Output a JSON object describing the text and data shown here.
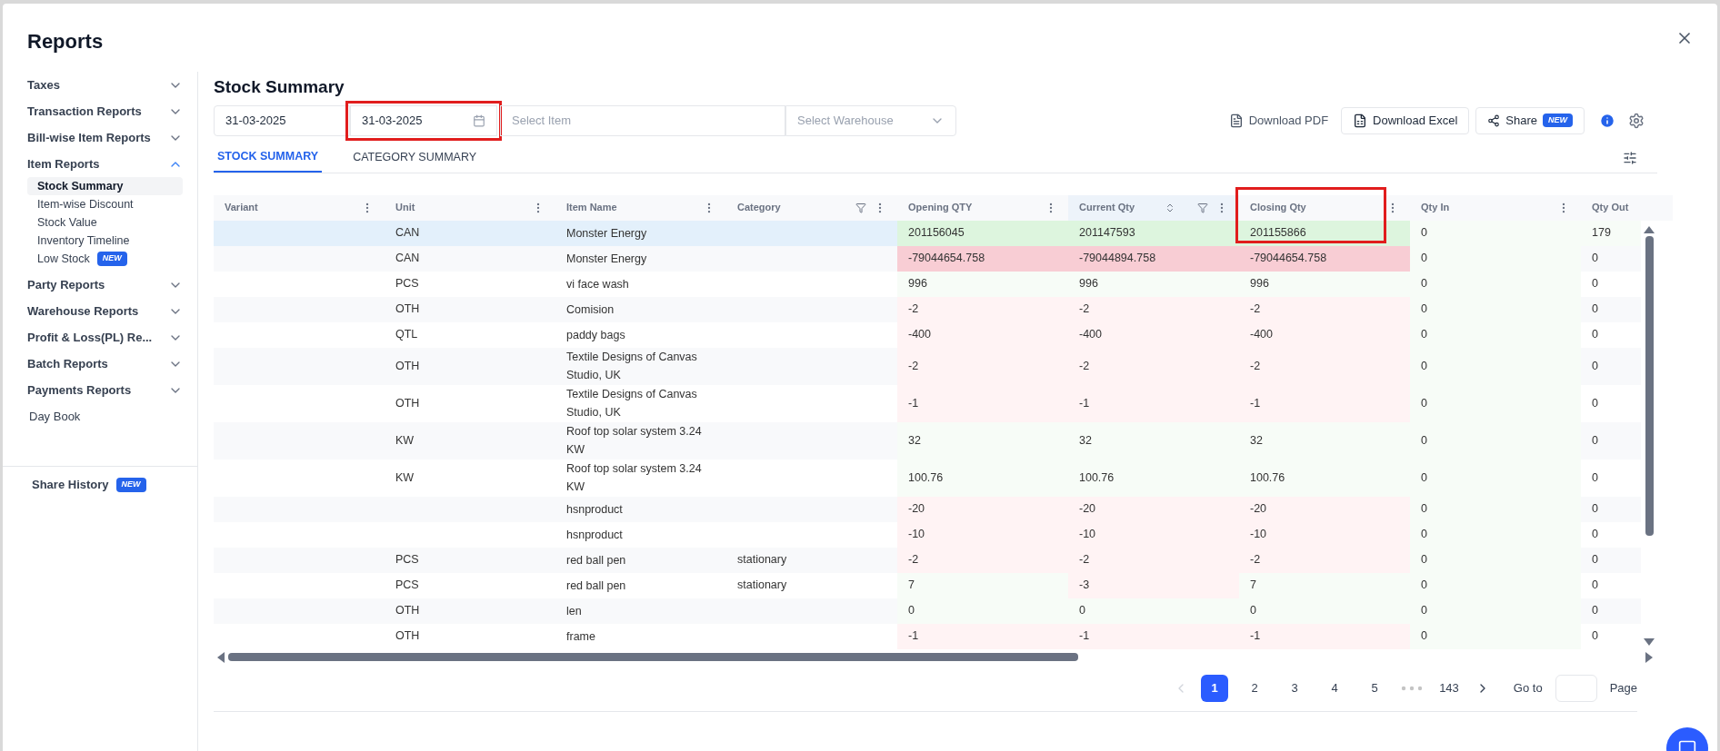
{
  "title": "Reports",
  "sidebar": {
    "items": [
      {
        "kind": "group",
        "label": "Taxes",
        "expanded": false
      },
      {
        "kind": "group",
        "label": "Transaction Reports",
        "expanded": false
      },
      {
        "kind": "group",
        "label": "Bill-wise Item Reports",
        "expanded": false
      },
      {
        "kind": "group",
        "label": "Item Reports",
        "expanded": true,
        "children": [
          {
            "label": "Stock Summary",
            "selected": true
          },
          {
            "label": "Item-wise Discount",
            "selected": false
          },
          {
            "label": "Stock Value",
            "selected": false
          },
          {
            "label": "Inventory Timeline",
            "selected": false
          },
          {
            "label": "Low Stock",
            "selected": false,
            "badge": "NEW"
          }
        ]
      },
      {
        "kind": "group",
        "label": "Party Reports",
        "expanded": false
      },
      {
        "kind": "group",
        "label": "Warehouse Reports",
        "expanded": false
      },
      {
        "kind": "group",
        "label": "Profit & Loss(PL) Re...",
        "expanded": false
      },
      {
        "kind": "group",
        "label": "Batch Reports",
        "expanded": false
      },
      {
        "kind": "group",
        "label": "Payments Reports",
        "expanded": false
      },
      {
        "kind": "link",
        "label": "Day Book"
      }
    ],
    "footer": {
      "label": "Share History",
      "badge": "NEW"
    }
  },
  "heading": "Stock Summary",
  "filters": {
    "start_date": {
      "value": "31-03-2025",
      "highlighted": false
    },
    "end_date": {
      "value": "31-03-2025",
      "highlighted": true
    },
    "item": {
      "placeholder": "Select Item"
    },
    "warehouse": {
      "placeholder": "Select Warehouse"
    }
  },
  "actions": {
    "download_pdf": "Download PDF",
    "download_excel": "Download Excel",
    "share": "Share",
    "share_badge": "NEW"
  },
  "tabs": [
    {
      "label": "STOCK SUMMARY",
      "selected": true
    },
    {
      "label": "CATEGORY SUMMARY",
      "selected": false
    }
  ],
  "table": {
    "columns": [
      {
        "label": "Variant",
        "filter": false,
        "sort": false,
        "menu": true,
        "highlighted": false
      },
      {
        "label": "Unit",
        "filter": false,
        "sort": false,
        "menu": true,
        "highlighted": false
      },
      {
        "label": "Item Name",
        "filter": false,
        "sort": false,
        "menu": true,
        "highlighted": false
      },
      {
        "label": "Category",
        "filter": true,
        "sort": false,
        "menu": true,
        "highlighted": false
      },
      {
        "label": "Opening QTY",
        "filter": false,
        "sort": false,
        "menu": true,
        "highlighted": false
      },
      {
        "label": "Current Qty",
        "filter": true,
        "sort": true,
        "menu": true,
        "highlighted": false
      },
      {
        "label": "Closing Qty",
        "filter": false,
        "sort": false,
        "menu": true,
        "highlighted": true
      },
      {
        "label": "Qty In",
        "filter": false,
        "sort": false,
        "menu": true,
        "highlighted": false
      },
      {
        "label": "Qty Out",
        "filter": false,
        "sort": false,
        "menu": false,
        "highlighted": false
      }
    ],
    "rows": [
      {
        "selected": true,
        "unit": "CAN",
        "item": "Monster Energy",
        "qty": [
          {
            "v": "201156045",
            "color": "#ddf5de"
          },
          {
            "v": "201147593",
            "color": "#ddf5de"
          },
          {
            "v": "201155866",
            "color": "#ddf5de"
          },
          {
            "v": "0",
            "color": "#f7fcf7"
          },
          {
            "v": "179",
            "color": "#f7fcf7"
          }
        ]
      },
      {
        "selected": false,
        "unit": "CAN",
        "item": "Monster Energy",
        "qty": [
          {
            "v": "-79044654.758",
            "color": "#f8cdd4"
          },
          {
            "v": "-79044894.758",
            "color": "#f8cdd4"
          },
          {
            "v": "-79044654.758",
            "color": "#f8cdd4"
          },
          {
            "v": "0",
            "color": "#f7fcf7"
          },
          {
            "v": "0"
          }
        ]
      },
      {
        "selected": false,
        "unit": "PCS",
        "item": "vi face wash",
        "qty": [
          {
            "v": "996",
            "color": "#f7fcf7"
          },
          {
            "v": "996",
            "color": "#f7fcf7"
          },
          {
            "v": "996",
            "color": "#f7fcf7"
          },
          {
            "v": "0",
            "color": "#f7fcf7"
          },
          {
            "v": "0"
          }
        ]
      },
      {
        "selected": false,
        "unit": "OTH",
        "item": "Comision",
        "qty": [
          {
            "v": "-2",
            "color": "#fff3f4"
          },
          {
            "v": "-2",
            "color": "#fff3f4"
          },
          {
            "v": "-2",
            "color": "#fff3f4"
          },
          {
            "v": "0",
            "color": "#f7fcf7"
          },
          {
            "v": "0"
          }
        ]
      },
      {
        "selected": false,
        "unit": "QTL",
        "item": "paddy bags",
        "qty": [
          {
            "v": "-400",
            "color": "#fff3f4"
          },
          {
            "v": "-400",
            "color": "#fff3f4"
          },
          {
            "v": "-400",
            "color": "#fff3f4"
          },
          {
            "v": "0",
            "color": "#f7fcf7"
          },
          {
            "v": "0"
          }
        ]
      },
      {
        "selected": false,
        "unit": "OTH",
        "item": "Textile Designs of Canvas Studio, UK",
        "qty": [
          {
            "v": "-2",
            "color": "#fff3f4"
          },
          {
            "v": "-2",
            "color": "#fff3f4"
          },
          {
            "v": "-2",
            "color": "#fff3f4"
          },
          {
            "v": "0",
            "color": "#f7fcf7"
          },
          {
            "v": "0"
          }
        ]
      },
      {
        "selected": false,
        "unit": "OTH",
        "item": "Textile Designs of Canvas Studio, UK",
        "qty": [
          {
            "v": "-1",
            "color": "#fff3f4"
          },
          {
            "v": "-1",
            "color": "#fff3f4"
          },
          {
            "v": "-1",
            "color": "#fff3f4"
          },
          {
            "v": "0",
            "color": "#f7fcf7"
          },
          {
            "v": "0"
          }
        ]
      },
      {
        "selected": false,
        "unit": "KW",
        "item": "Roof top solar system 3.24 KW",
        "qty": [
          {
            "v": "32",
            "color": "#f7fcf7"
          },
          {
            "v": "32",
            "color": "#f7fcf7"
          },
          {
            "v": "32",
            "color": "#f7fcf7"
          },
          {
            "v": "0",
            "color": "#f7fcf7"
          },
          {
            "v": "0"
          }
        ]
      },
      {
        "selected": false,
        "unit": "KW",
        "item": "Roof top solar system 3.24 KW",
        "qty": [
          {
            "v": "100.76",
            "color": "#f7fcf7"
          },
          {
            "v": "100.76",
            "color": "#f7fcf7"
          },
          {
            "v": "100.76",
            "color": "#f7fcf7"
          },
          {
            "v": "0",
            "color": "#f7fcf7"
          },
          {
            "v": "0"
          }
        ]
      },
      {
        "selected": false,
        "item": "hsnproduct",
        "qty": [
          {
            "v": "-20",
            "color": "#fff3f4"
          },
          {
            "v": "-20",
            "color": "#fff3f4"
          },
          {
            "v": "-20",
            "color": "#fff3f4"
          },
          {
            "v": "0",
            "color": "#f7fcf7"
          },
          {
            "v": "0"
          }
        ]
      },
      {
        "selected": false,
        "item": "hsnproduct",
        "qty": [
          {
            "v": "-10",
            "color": "#fff3f4"
          },
          {
            "v": "-10",
            "color": "#fff3f4"
          },
          {
            "v": "-10",
            "color": "#fff3f4"
          },
          {
            "v": "0",
            "color": "#f7fcf7"
          },
          {
            "v": "0"
          }
        ]
      },
      {
        "selected": false,
        "unit": "PCS",
        "item": "red ball pen",
        "category": "stationary",
        "qty": [
          {
            "v": "-2",
            "color": "#fff3f4"
          },
          {
            "v": "-2",
            "color": "#fff3f4"
          },
          {
            "v": "-2",
            "color": "#fff3f4"
          },
          {
            "v": "0",
            "color": "#f7fcf7"
          },
          {
            "v": "0"
          }
        ]
      },
      {
        "selected": false,
        "unit": "PCS",
        "item": "red ball pen",
        "category": "stationary",
        "qty": [
          {
            "v": "7",
            "color": "#f7fcf7"
          },
          {
            "v": "-3",
            "color": "#fff3f4"
          },
          {
            "v": "7",
            "color": "#f7fcf7"
          },
          {
            "v": "0",
            "color": "#f7fcf7"
          },
          {
            "v": "0"
          }
        ]
      },
      {
        "selected": false,
        "unit": "OTH",
        "item": "len",
        "qty": [
          {
            "v": "0",
            "color": "#f7fcf7"
          },
          {
            "v": "0",
            "color": "#f7fcf7"
          },
          {
            "v": "0",
            "color": "#f7fcf7"
          },
          {
            "v": "0",
            "color": "#f7fcf7"
          },
          {
            "v": "0"
          }
        ]
      },
      {
        "selected": false,
        "unit": "OTH",
        "item": "frame",
        "qty": [
          {
            "v": "-1",
            "color": "#fff3f4"
          },
          {
            "v": "-1",
            "color": "#fff3f4"
          },
          {
            "v": "-1",
            "color": "#fff3f4"
          },
          {
            "v": "0",
            "color": "#f7fcf7"
          },
          {
            "v": "0"
          }
        ]
      }
    ]
  },
  "pagination": {
    "prev_disabled": true,
    "pages": [
      {
        "label": "1",
        "selected": true
      },
      {
        "label": "2",
        "selected": false
      },
      {
        "label": "3",
        "selected": false
      },
      {
        "label": "4",
        "selected": false
      },
      {
        "label": "5",
        "selected": false
      }
    ],
    "last_page": "143",
    "goto_label": "Go to",
    "page_label": "Page"
  }
}
